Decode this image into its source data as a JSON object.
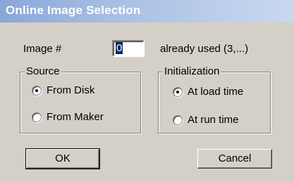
{
  "window": {
    "title": "Online Image Selection"
  },
  "image": {
    "label": "Image #",
    "value": "0",
    "already_used": "already used (3,...)"
  },
  "source": {
    "legend": "Source",
    "options": [
      {
        "label": "From Disk",
        "selected": true
      },
      {
        "label": "From Maker",
        "selected": false
      }
    ]
  },
  "initialization": {
    "legend": "Initialization",
    "options": [
      {
        "label": "At load time",
        "selected": true
      },
      {
        "label": "At run  time",
        "selected": false
      }
    ]
  },
  "buttons": {
    "ok": "OK",
    "cancel": "Cancel"
  }
}
